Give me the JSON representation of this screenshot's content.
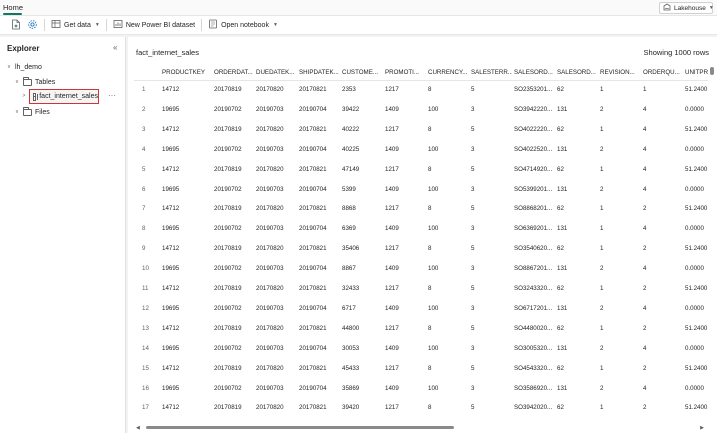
{
  "topbar": {
    "home_tab": "Home",
    "lakehouse_label": "Lakehouse"
  },
  "ribbon": {
    "get_data": "Get data",
    "new_dataset": "New Power BI dataset",
    "open_notebook": "Open notebook"
  },
  "explorer": {
    "title": "Explorer",
    "root": "lh_demo",
    "tables_folder": "Tables",
    "selected_table": "fact_internet_sales",
    "files_folder": "Files"
  },
  "main": {
    "title": "fact_internet_sales",
    "row_count": "Showing 1000 rows",
    "columns": [
      "",
      "PRODUCTKEY",
      "ORDERDAT...",
      "DUEDATEK...",
      "SHIPDATEK...",
      "CUSTOME...",
      "PROMOTI...",
      "CURRENCY...",
      "SALESTERR...",
      "SALESORD...",
      "SALESORD...",
      "REVISION...",
      "ORDERQU...",
      "UNITPR"
    ],
    "rows": [
      [
        "1",
        "14712",
        "20170819",
        "20170820",
        "20170821",
        "2353",
        "1217",
        "8",
        "5",
        "SO2353201...",
        "62",
        "1",
        "1",
        "51.2400"
      ],
      [
        "2",
        "19695",
        "20190702",
        "20190703",
        "20190704",
        "39422",
        "1409",
        "100",
        "3",
        "SO3942220...",
        "131",
        "2",
        "4",
        "0.0000"
      ],
      [
        "3",
        "14712",
        "20170819",
        "20170820",
        "20170821",
        "40222",
        "1217",
        "8",
        "5",
        "SO4022220...",
        "62",
        "1",
        "4",
        "51.2400"
      ],
      [
        "4",
        "19695",
        "20190702",
        "20190703",
        "20190704",
        "40225",
        "1409",
        "100",
        "3",
        "SO4022520...",
        "131",
        "2",
        "4",
        "0.0000"
      ],
      [
        "5",
        "14712",
        "20170819",
        "20170820",
        "20170821",
        "47149",
        "1217",
        "8",
        "5",
        "SO4714920...",
        "62",
        "1",
        "4",
        "51.2400"
      ],
      [
        "6",
        "19695",
        "20190702",
        "20190703",
        "20190704",
        "5399",
        "1409",
        "100",
        "3",
        "SO5399201...",
        "131",
        "2",
        "4",
        "0.0000"
      ],
      [
        "7",
        "14712",
        "20170819",
        "20170820",
        "20170821",
        "8868",
        "1217",
        "8",
        "5",
        "SO8868201...",
        "62",
        "1",
        "2",
        "51.2400"
      ],
      [
        "8",
        "19695",
        "20190702",
        "20190703",
        "20190704",
        "6369",
        "1409",
        "100",
        "3",
        "SO6369201...",
        "131",
        "1",
        "4",
        "0.0000"
      ],
      [
        "9",
        "14712",
        "20170819",
        "20170820",
        "20170821",
        "35406",
        "1217",
        "8",
        "5",
        "SO3540620...",
        "62",
        "1",
        "2",
        "51.2400"
      ],
      [
        "10",
        "19695",
        "20190702",
        "20190703",
        "20190704",
        "8867",
        "1409",
        "100",
        "3",
        "SO8867201...",
        "131",
        "2",
        "4",
        "0.0000"
      ],
      [
        "11",
        "14712",
        "20170819",
        "20170820",
        "20170821",
        "32433",
        "1217",
        "8",
        "5",
        "SO3243320...",
        "62",
        "1",
        "2",
        "51.2400"
      ],
      [
        "12",
        "19695",
        "20190702",
        "20190703",
        "20190704",
        "6717",
        "1409",
        "100",
        "3",
        "SO6717201...",
        "131",
        "2",
        "4",
        "0.0000"
      ],
      [
        "13",
        "14712",
        "20170819",
        "20170820",
        "20170821",
        "44800",
        "1217",
        "8",
        "5",
        "SO4480020...",
        "62",
        "1",
        "2",
        "51.2400"
      ],
      [
        "14",
        "19695",
        "20190702",
        "20190703",
        "20190704",
        "30053",
        "1409",
        "100",
        "3",
        "SO3005320...",
        "131",
        "2",
        "4",
        "0.0000"
      ],
      [
        "15",
        "14712",
        "20170819",
        "20170820",
        "20170821",
        "45433",
        "1217",
        "8",
        "5",
        "SO4543320...",
        "62",
        "1",
        "2",
        "51.2400"
      ],
      [
        "16",
        "19695",
        "20190702",
        "20190703",
        "20190704",
        "35869",
        "1409",
        "100",
        "3",
        "SO3586920...",
        "131",
        "2",
        "4",
        "0.0000"
      ],
      [
        "17",
        "14712",
        "20170819",
        "20170820",
        "20170821",
        "39420",
        "1217",
        "8",
        "5",
        "SO3942020...",
        "62",
        "1",
        "2",
        "51.2400"
      ]
    ]
  }
}
